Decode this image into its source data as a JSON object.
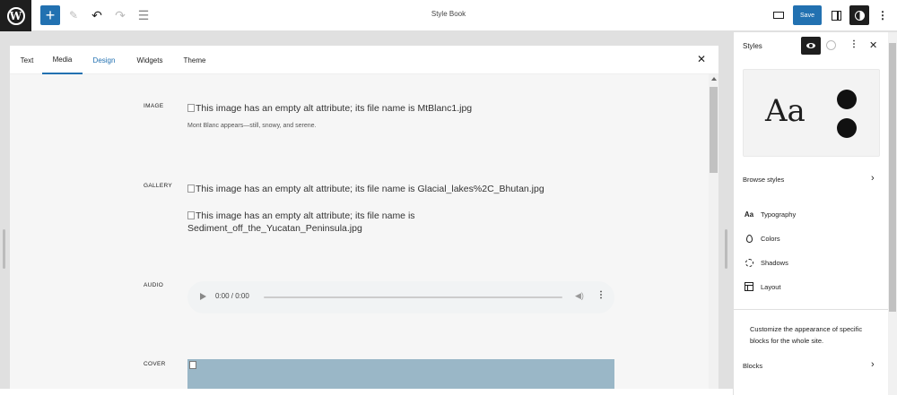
{
  "topbar": {
    "title": "Style Book",
    "add_icon": "plus-icon",
    "save_label": "Save"
  },
  "tabs": [
    {
      "label": "Text"
    },
    {
      "label": "Media"
    },
    {
      "label": "Design"
    },
    {
      "label": "Widgets"
    },
    {
      "label": "Theme"
    }
  ],
  "content": {
    "image": {
      "label": "IMAGE",
      "alt": "This image has an empty alt attribute; its file name is MtBlanc1.jpg",
      "caption": "Mont Blanc appears—still, snowy, and serene."
    },
    "gallery": {
      "label": "GALLERY",
      "alt1": "This image has an empty alt attribute; its file name is Glacial_lakes%2C_Bhutan.jpg",
      "alt2_line1": "This image has an empty alt attribute; its file name is",
      "alt2_line2": "Sediment_off_the_Yucatan_Peninsula.jpg"
    },
    "audio": {
      "label": "AUDIO",
      "time": "0:00 / 0:00"
    },
    "cover": {
      "label": "COVER",
      "color": "#9ab7c7"
    }
  },
  "sidebar": {
    "title": "Styles",
    "preview_text": "Aa",
    "browse_styles": "Browse styles",
    "menu": [
      {
        "label": "Typography",
        "icon": "typography-icon"
      },
      {
        "label": "Colors",
        "icon": "droplet-icon"
      },
      {
        "label": "Shadows",
        "icon": "shadow-icon"
      },
      {
        "label": "Layout",
        "icon": "layout-icon"
      }
    ],
    "description": "Customize the appearance of specific blocks for the whole site.",
    "blocks": "Blocks"
  },
  "colors": {
    "accent": "#2271b1",
    "dark": "#1e1e1e"
  }
}
